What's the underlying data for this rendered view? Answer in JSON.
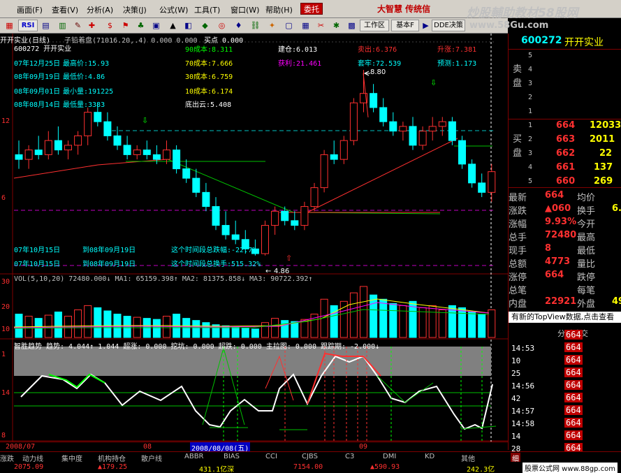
{
  "menu": {
    "items": [
      "画面(F)",
      "查看(V)",
      "分析(A)",
      "决策(J)",
      "公式(W)",
      "工具(T)",
      "窗口(W)",
      "帮助(H)"
    ],
    "buy_button": "委托",
    "brand": "大智慧 传统信",
    "watermark_title": "炒股輔助教材58股网",
    "watermark_url": "www.58Gu.com"
  },
  "toolbar": {
    "rsi": "RSI",
    "workspace": "工作区",
    "basic": "基本F",
    "dde": "DDE决策"
  },
  "stock": {
    "code_name": "600272 开开实业",
    "header_line": "开开实业(日线)",
    "hist_label": "子铅着盘(71016.20,.4) 0.000 0.000",
    "buy_point": "买点 0.000",
    "stats": [
      {
        "date": "07年12月25日",
        "label": "最高价:15.93"
      },
      {
        "date": "08年09月19日",
        "label": "最低价:4.86"
      },
      {
        "date": "08年09月01日",
        "label": "最小量:191225"
      },
      {
        "date": "08年08月14日",
        "label": "最低量:3383"
      }
    ],
    "cost_90": "90成本:8.311",
    "cost_70": "70成本:7.666",
    "cost_30": "30成本:6.759",
    "cost_10": "10成本:6.174",
    "bottom_out": "底出云:5.408",
    "build": "建仓:6.013",
    "profit": "获利:21.461",
    "sell": "卖出:6.376",
    "winrate": "套牢:72.539",
    "rise": "升涨:7.381",
    "forecast": "预测:1.173",
    "price_high": "8.80",
    "price_low": "4.86",
    "range1_from": "07年10月15日",
    "range1_to": "到08年09月19日",
    "range1_desc": "这个时间段总跌幅:-22.7%",
    "range2_from": "07年10月15日",
    "range2_to": "到08年09月19日",
    "range2_desc": "这个时间段总换手:515.32%",
    "y_labels": [
      "12",
      "6"
    ]
  },
  "volume": {
    "header": "VOL(5,10,20) 72480.000↓ MA1: 65159.398↑ MA2: 81375.858↓ MA3: 90722.392↑",
    "y_labels": [
      "30",
      "20",
      "10"
    ]
  },
  "indicator": {
    "header": "智胜趋势 趋势: 4.044↑ 1.044 超涨: 0.000 挖坑: 0.000 超跌: 0.000 主拉图: 0.000 跟踪期: -2.000↓",
    "y_labels": [
      "1",
      "14",
      "8"
    ]
  },
  "time_axis": {
    "left_date": "2008/07",
    "mid_mark": "08",
    "current": "2008/08/08(五)",
    "right_mark": "09"
  },
  "bottom_tabs": [
    "涨跌",
    "动力线",
    "集中度",
    "机构持仓",
    "散户线",
    "ABBR",
    "BIAS",
    "CCI",
    "CJBS",
    "C3",
    "DMI",
    "KD",
    "其他"
  ],
  "quote": {
    "title_code": "600272",
    "title_name": "开开实业",
    "sell_levels": [
      "5",
      "4",
      "3",
      "2",
      "1"
    ],
    "buy_levels": [
      {
        "lvl": "1",
        "price": "664",
        "vol": "12033"
      },
      {
        "lvl": "2",
        "price": "663",
        "vol": "2011"
      },
      {
        "lvl": "3",
        "price": "662",
        "vol": "22"
      },
      {
        "lvl": "4",
        "price": "661",
        "vol": "137"
      },
      {
        "lvl": "5",
        "price": "660",
        "vol": "269"
      }
    ],
    "sell_label": "卖盘",
    "buy_label": "买盘",
    "rows": [
      {
        "k1": "最新",
        "v1": "664",
        "k2": "均价",
        "v2": ""
      },
      {
        "k1": "涨跌",
        "v1": "▲060",
        "k2": "换手",
        "v2": "6."
      },
      {
        "k1": "涨幅",
        "v1": "9.93%",
        "k2": "今开",
        "v2": ""
      },
      {
        "k1": "总手",
        "v1": "72480",
        "k2": "最高",
        "v2": ""
      },
      {
        "k1": "现手",
        "v1": "8",
        "k2": "最低",
        "v2": ""
      },
      {
        "k1": "总额",
        "v1": "4773",
        "k2": "量比",
        "v2": ""
      },
      {
        "k1": "涨停",
        "v1": "664",
        "k2": "跌停",
        "v2": ""
      },
      {
        "k1": "总笔",
        "v1": "",
        "k2": "每笔",
        "v2": ""
      },
      {
        "k1": "内盘",
        "v1": "22921",
        "k2": "外盘",
        "v2": "49"
      }
    ],
    "topview": "有新的TopView数据,点击查看",
    "ticks_header": "分时成交",
    "ticks": [
      {
        "time": "",
        "price": "664"
      },
      {
        "time": "14:53",
        "price": "664"
      },
      {
        "time": "10",
        "price": "664"
      },
      {
        "time": "25",
        "price": "664"
      },
      {
        "time": "14:56",
        "price": "664"
      },
      {
        "time": "42",
        "price": "664"
      },
      {
        "time": "14:57",
        "price": "664"
      },
      {
        "time": "14:58",
        "price": "664"
      },
      {
        "time": "14",
        "price": "664"
      },
      {
        "time": "28",
        "price": "664"
      }
    ],
    "tab_fine": "细"
  },
  "status": {
    "idx1": "2075.09",
    "idx1_chg": "▲179.25",
    "idx2": "431.1亿深",
    "idx3": "7154.00",
    "idx3_chg": "▲590.93",
    "idx4": "242.3亿",
    "footer": "股票公式网 www.88gp.com"
  },
  "colors": {
    "up": "#ff3030",
    "down": "#00ffff",
    "yellow": "#ffff00",
    "white": "#ffffff",
    "green": "#00ff00",
    "magenta": "#ff00ff",
    "bg": "#000000"
  },
  "chart_data": {
    "type": "candlestick",
    "candles": [
      [
        7.0,
        7.3,
        6.7,
        6.9
      ],
      [
        6.9,
        7.2,
        6.7,
        7.1
      ],
      [
        7.1,
        7.4,
        6.9,
        7.0
      ],
      [
        7.0,
        7.5,
        6.9,
        7.3
      ],
      [
        7.3,
        7.6,
        7.0,
        7.1
      ],
      [
        7.1,
        7.3,
        6.9,
        7.2
      ],
      [
        7.2,
        7.5,
        7.0,
        7.4
      ],
      [
        7.4,
        8.0,
        7.2,
        7.9
      ],
      [
        7.9,
        8.1,
        7.6,
        7.7
      ],
      [
        7.7,
        7.9,
        7.3,
        7.4
      ],
      [
        7.4,
        7.6,
        7.1,
        7.2
      ],
      [
        7.2,
        7.4,
        6.9,
        7.0
      ],
      [
        7.0,
        7.2,
        6.9,
        7.1
      ],
      [
        7.1,
        7.3,
        6.9,
        7.0
      ],
      [
        7.0,
        7.2,
        6.8,
        6.9
      ],
      [
        6.9,
        7.3,
        6.8,
        7.1
      ],
      [
        7.1,
        7.2,
        6.6,
        6.7
      ],
      [
        6.7,
        6.9,
        6.4,
        6.5
      ],
      [
        6.5,
        6.7,
        6.1,
        6.2
      ],
      [
        6.2,
        6.4,
        5.8,
        5.9
      ],
      [
        5.9,
        6.1,
        5.4,
        5.5
      ],
      [
        5.5,
        5.8,
        5.2,
        5.3
      ],
      [
        5.3,
        5.6,
        5.1,
        5.2
      ],
      [
        5.2,
        5.4,
        4.9,
        5.0
      ],
      [
        5.0,
        5.2,
        4.86,
        4.9
      ],
      [
        4.9,
        5.6,
        4.86,
        5.5
      ],
      [
        5.5,
        5.9,
        5.3,
        5.8
      ],
      [
        5.8,
        5.9,
        5.5,
        5.6
      ],
      [
        5.6,
        5.8,
        5.4,
        5.5
      ],
      [
        5.5,
        6.0,
        5.4,
        5.9
      ],
      [
        5.9,
        6.4,
        5.8,
        6.3
      ],
      [
        6.3,
        7.1,
        6.2,
        7.0
      ],
      [
        7.0,
        7.3,
        6.8,
        6.9
      ],
      [
        6.9,
        7.4,
        6.8,
        7.3
      ],
      [
        7.3,
        8.2,
        7.2,
        8.1
      ],
      [
        8.1,
        8.8,
        7.9,
        8.3
      ],
      [
        8.3,
        8.5,
        7.9,
        8.0
      ],
      [
        8.0,
        8.2,
        7.6,
        7.7
      ],
      [
        7.7,
        7.9,
        7.4,
        7.5
      ],
      [
        7.5,
        7.7,
        7.3,
        7.6
      ],
      [
        7.6,
        7.8,
        7.1,
        7.2
      ],
      [
        7.2,
        7.6,
        7.1,
        7.5
      ],
      [
        7.5,
        7.8,
        7.3,
        7.6
      ],
      [
        7.6,
        7.8,
        7.4,
        7.7
      ],
      [
        7.7,
        7.8,
        7.2,
        7.3
      ],
      [
        7.3,
        7.4,
        6.7,
        6.8
      ],
      [
        6.8,
        6.9,
        6.3,
        6.4
      ],
      [
        6.4,
        6.6,
        6.1,
        6.2
      ],
      [
        6.2,
        6.8,
        6.0,
        6.64
      ]
    ],
    "volumes": [
      22,
      20,
      18,
      21,
      24,
      20,
      26,
      30,
      28,
      25,
      22,
      20,
      19,
      18,
      17,
      20,
      22,
      18,
      16,
      14,
      12,
      11,
      10,
      9,
      8,
      14,
      18,
      16,
      15,
      17,
      22,
      36,
      30,
      34,
      42,
      48,
      40,
      36,
      32,
      30,
      34,
      28,
      30,
      26,
      30,
      28,
      24,
      22,
      26
    ],
    "ylim": [
      4.5,
      9.2
    ]
  }
}
